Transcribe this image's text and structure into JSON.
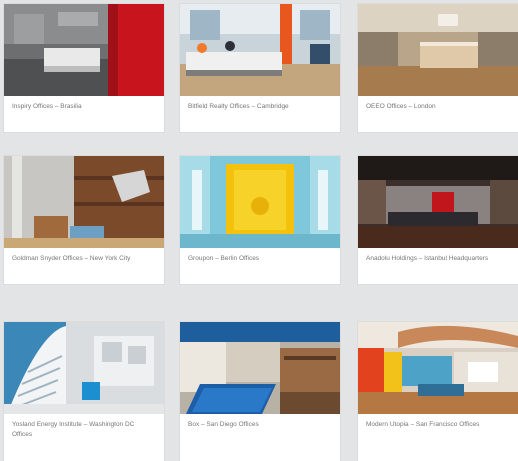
{
  "gallery": {
    "items": [
      {
        "caption": "Inspiry Offices – Brasilia",
        "image": "lobby with red wall and white reception desk"
      },
      {
        "caption": "Bitfield Realty Offices – Cambridge",
        "image": "reception with orange pillar and flowers"
      },
      {
        "caption": "OEEO Offices – London",
        "image": "warm lit open office with long bench"
      },
      {
        "caption": "Goldman Snyder Offices – New York City",
        "image": "wood panelled lounge with blue armchair"
      },
      {
        "caption": "Groupon – Berlin Offices",
        "image": "bright yellow meeting pod in blue room"
      },
      {
        "caption": "Anadolu Holdings – Istanbul Headquarters",
        "image": "dark lounge with red artwork"
      },
      {
        "caption": "Yosland Energy Institute – Washington DC Offices",
        "image": "white spiral staircase with blue accents"
      },
      {
        "caption": "Box – San Diego Offices",
        "image": "blue pool table under blue ceiling"
      },
      {
        "caption": "Modern Utopia – San Francisco Offices",
        "image": "open office with orange and yellow walls"
      }
    ]
  }
}
